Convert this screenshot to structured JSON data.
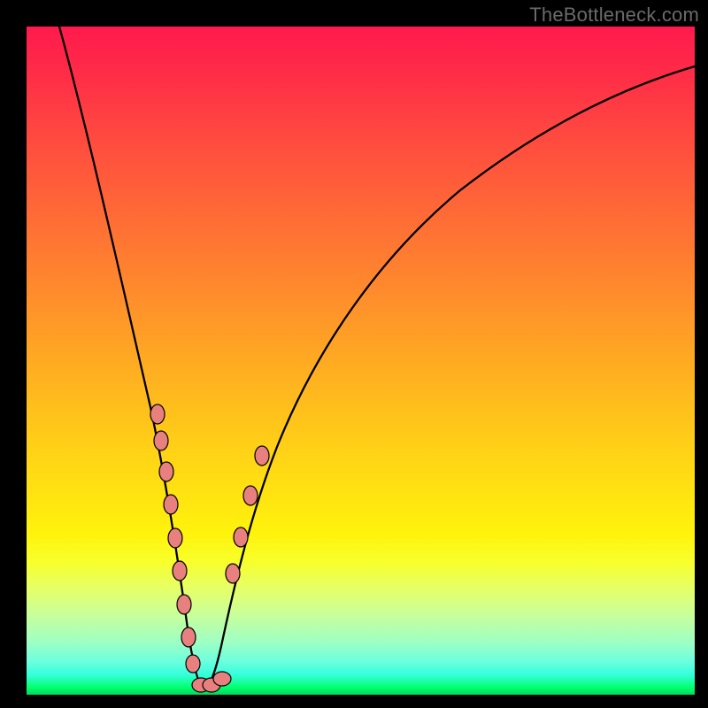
{
  "watermark": "TheBottleneck.com",
  "chart_data": {
    "type": "line",
    "title": "",
    "xlabel": "",
    "ylabel": "",
    "xlim": [
      0,
      100
    ],
    "ylim": [
      0,
      100
    ],
    "grid": false,
    "legend": false,
    "note": "Gradient background: red=high (top) to green=low (bottom). Curve is a V-shaped bottleneck profile with minimum near x≈26. Beads mark data samples along the curve.",
    "series": [
      {
        "name": "bottleneck-curve",
        "x": [
          5,
          8,
          11,
          14,
          17,
          19,
          20,
          21,
          22,
          23,
          24,
          25,
          26,
          27,
          28,
          29,
          30,
          32,
          34,
          37,
          41,
          46,
          52,
          59,
          67,
          76,
          86,
          97,
          100
        ],
        "values": [
          100,
          90,
          79,
          68,
          56,
          47,
          42,
          37,
          31,
          25,
          18,
          10,
          2,
          2,
          7,
          14,
          21,
          30,
          37,
          45,
          53,
          60,
          67,
          73,
          78,
          82,
          85,
          87,
          87.5
        ]
      }
    ],
    "beads_left": {
      "x": [
        20.0,
        20.6,
        21.6,
        22.4,
        23.1,
        23.8,
        24.4,
        25.0,
        25.6
      ],
      "values": [
        42,
        38,
        33,
        28,
        23,
        18,
        13,
        8,
        4
      ]
    },
    "beads_right": {
      "x": [
        29.8,
        30.7,
        31.9,
        33.5
      ],
      "values": [
        20,
        26,
        32,
        38
      ]
    },
    "beads_bottom": {
      "x": [
        26.0,
        27.0,
        27.9
      ],
      "values": [
        2,
        2,
        3
      ]
    }
  }
}
